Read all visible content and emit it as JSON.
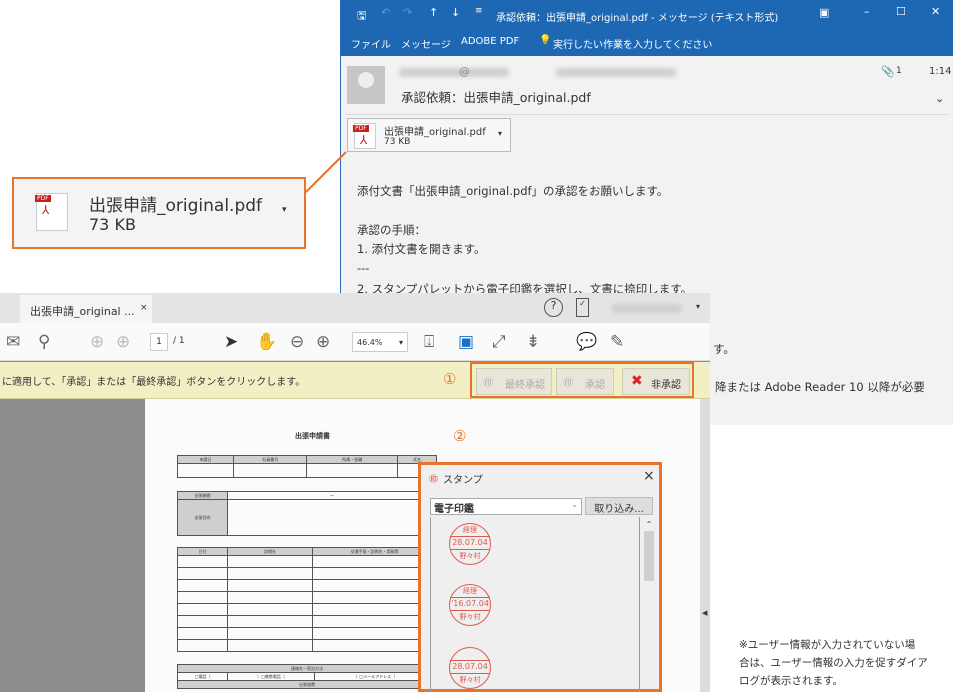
{
  "outlook": {
    "title": "承認依頼：出張申請_original.pdf - メッセージ (テキスト形式)",
    "ribbon": [
      "ファイル",
      "メッセージ",
      "ADOBE PDF"
    ],
    "tell_me": "実行したい作業を入力してください",
    "at": "@",
    "attach_count": "1",
    "time": "1:14",
    "subject": "承認依頼：出張申請_original.pdf",
    "attachment": {
      "name": "出張申請_original.pdf",
      "size": "73 KB"
    },
    "body": [
      "添付文書「出張申請_original.pdf」の承認をお願いします。",
      "承認の手順：",
      "1. 添付文書を開きます。",
      "---",
      "2. スタンプパレットから電子印鑑を選択し、文書に捺印します。",
      "す。",
      "降または Adobe Reader 10 以降が必要"
    ]
  },
  "callout": {
    "name": "出張申請_original.pdf",
    "size": "73 KB"
  },
  "acrobat": {
    "tab": "出張申請_original ...",
    "page": "1",
    "pages": "/ 1",
    "zoom": "46.4%",
    "message": "に適用して、「承認」または「最終承認」ボタンをクリックします。",
    "buttons": {
      "final": "最終承認",
      "approve": "承認",
      "reject": "非承認"
    },
    "doc": {
      "title": "出張申請書",
      "row1": [
        "申請日",
        "社員番号",
        "所属・役職",
        "氏名"
      ],
      "period": "出張期間",
      "dash": "～",
      "purpose": "出張目的",
      "row3": [
        "日付",
        "訪問先",
        "交通手段・訪問先・用務等"
      ],
      "contact": "連絡先・宿泊方法",
      "contact_opts": [
        "□電話（",
        "）□携帯電話（",
        "）□メールアドレス（"
      ],
      "expenses": "出張旅費"
    }
  },
  "markers": [
    "①",
    "②"
  ],
  "stamp": {
    "title": "スタンプ",
    "category": "電子印鑑",
    "import": "取り込み...",
    "seals": [
      {
        "top": "経理",
        "date": "28.07.04",
        "name": "野々村"
      },
      {
        "top": "経理",
        "date": "'16.07.04",
        "name": "野々村"
      },
      {
        "top": "",
        "date": "28.07.04",
        "name": "野々村"
      }
    ]
  },
  "note": [
    "※ユーザー情報が入力されていない場",
    "合は、ユーザー情報の入力を促すダイア",
    "ログが表示されます。"
  ]
}
